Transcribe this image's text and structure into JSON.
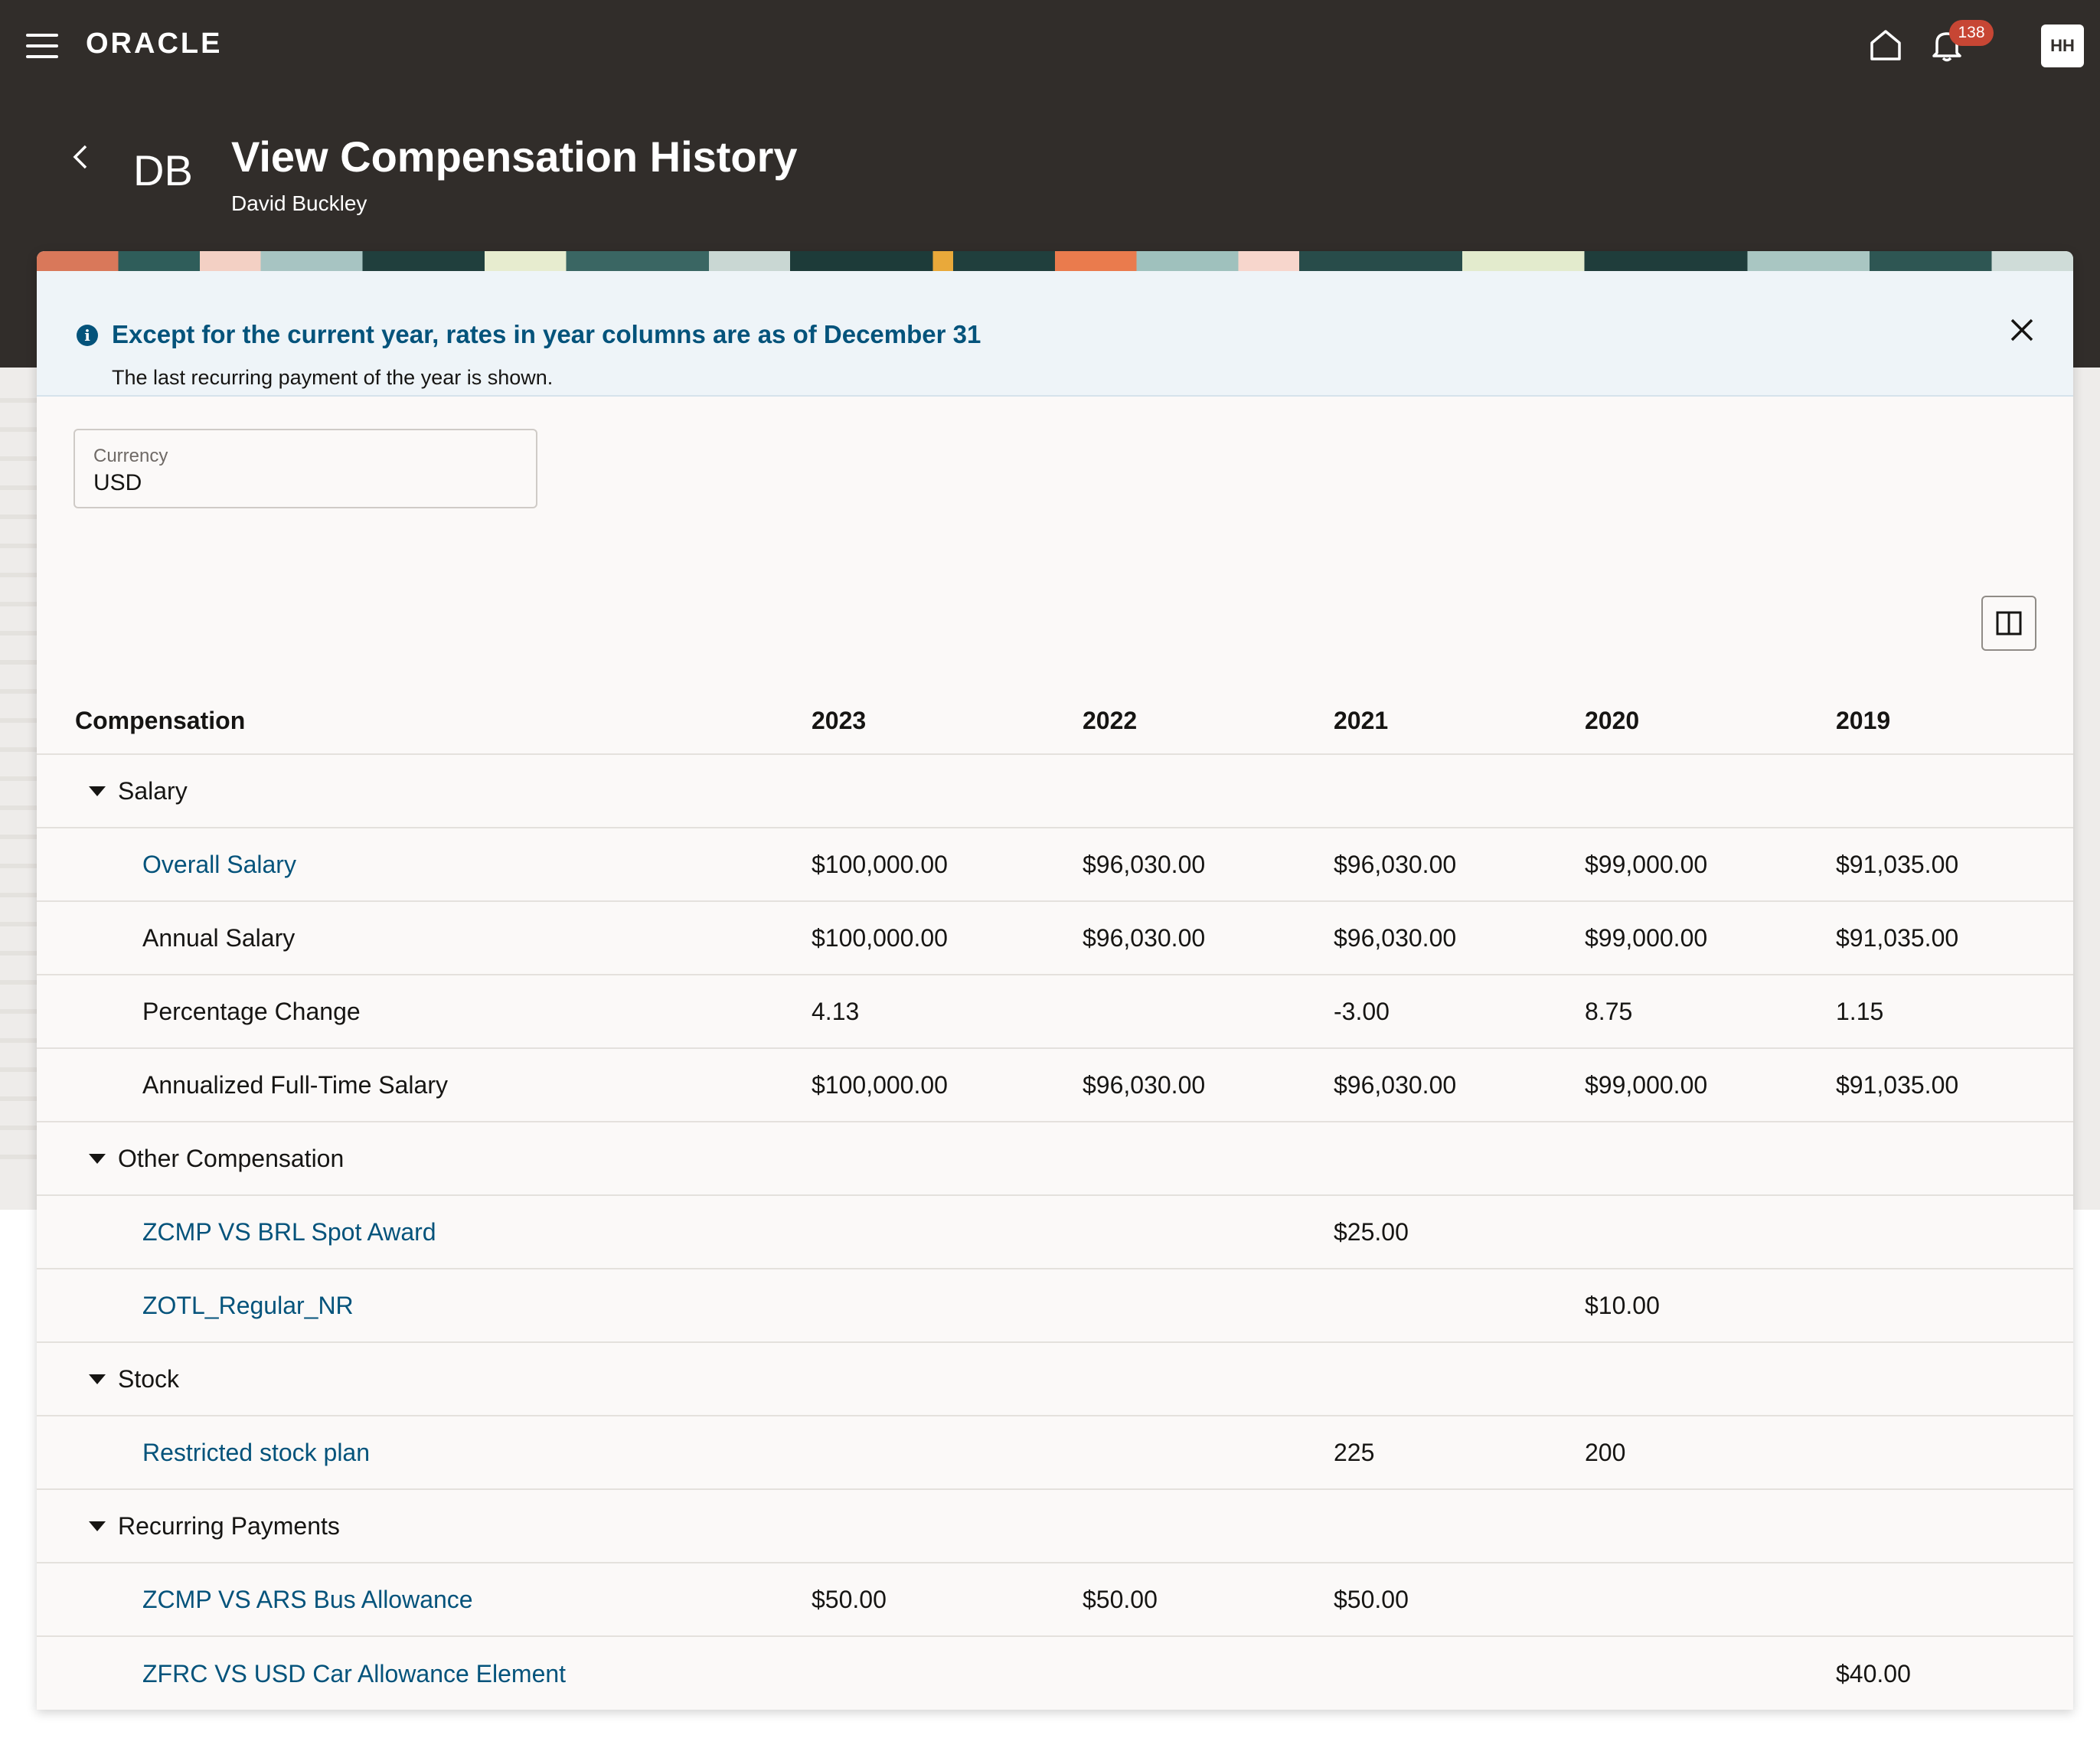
{
  "header": {
    "logo": "ORACLE",
    "notification_count": "138",
    "user_initials": "HH"
  },
  "page": {
    "initials": "DB",
    "title": "View Compensation History",
    "subtitle": "David Buckley"
  },
  "info_banner": {
    "title": "Except for the current year, rates in year columns are as of December 31",
    "text": "The last recurring payment of the year is shown.",
    "icon": "info-icon"
  },
  "currency": {
    "label": "Currency",
    "value": "USD"
  },
  "table": {
    "columns": [
      "Compensation",
      "2023",
      "2022",
      "2021",
      "2020",
      "2019"
    ],
    "groups": [
      {
        "label": "Salary",
        "rows": [
          {
            "name": "Overall Salary",
            "link": true,
            "values": [
              "$100,000.00",
              "$96,030.00",
              "$96,030.00",
              "$99,000.00",
              "$91,035.00"
            ]
          },
          {
            "name": "Annual Salary",
            "link": false,
            "values": [
              "$100,000.00",
              "$96,030.00",
              "$96,030.00",
              "$99,000.00",
              "$91,035.00"
            ]
          },
          {
            "name": "Percentage Change",
            "link": false,
            "values": [
              "4.13",
              "",
              "-3.00",
              "8.75",
              "1.15"
            ]
          },
          {
            "name": "Annualized Full-Time Salary",
            "link": false,
            "values": [
              "$100,000.00",
              "$96,030.00",
              "$96,030.00",
              "$99,000.00",
              "$91,035.00"
            ]
          }
        ]
      },
      {
        "label": "Other Compensation",
        "rows": [
          {
            "name": "ZCMP VS BRL Spot Award",
            "link": true,
            "values": [
              "",
              "",
              "$25.00",
              "",
              ""
            ]
          },
          {
            "name": "ZOTL_Regular_NR",
            "link": true,
            "values": [
              "",
              "",
              "",
              "$10.00",
              ""
            ]
          }
        ]
      },
      {
        "label": "Stock",
        "rows": [
          {
            "name": "Restricted stock plan",
            "link": true,
            "values": [
              "",
              "",
              "225",
              "200",
              ""
            ]
          }
        ]
      },
      {
        "label": "Recurring Payments",
        "rows": [
          {
            "name": "ZCMP VS ARS Bus Allowance",
            "link": true,
            "values": [
              "$50.00",
              "$50.00",
              "$50.00",
              "",
              ""
            ]
          },
          {
            "name": "ZFRC VS USD Car Allowance Element",
            "link": true,
            "values": [
              "",
              "",
              "",
              "",
              "$40.00"
            ]
          }
        ]
      }
    ]
  },
  "colors": {
    "header_bg": "#312d2a",
    "link": "#04537b",
    "badge": "#c74634",
    "info_bg": "#eef4f8"
  }
}
